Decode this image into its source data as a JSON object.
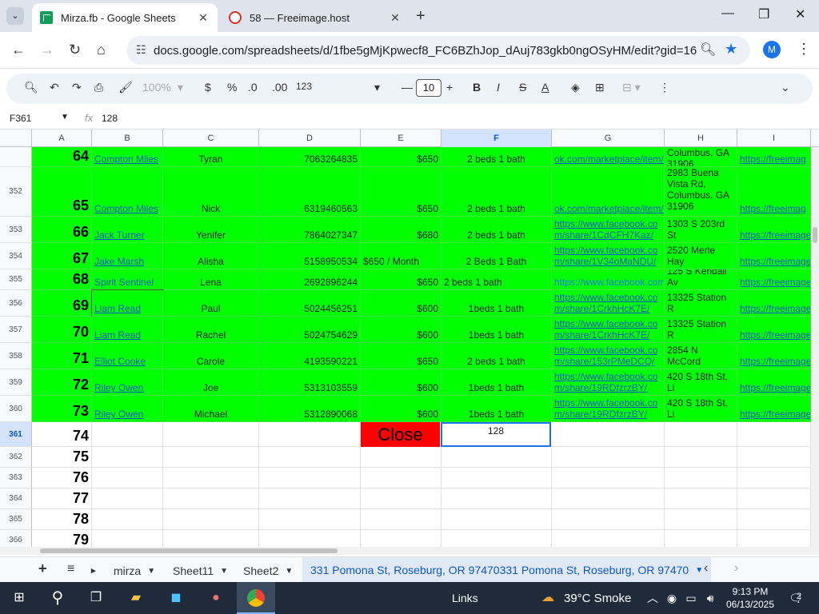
{
  "browser": {
    "tabs": [
      {
        "title": "Mirza.fb - Google Sheets",
        "active": true
      },
      {
        "title": "58 — Freeimage.host",
        "active": false
      }
    ],
    "url": "docs.google.com/spreadsheets/d/1fbe5gMjKpwecf8_FC6BZhJop_dAuj783gkb0ngOSyHM/edit?gid=166569...",
    "profile_initial": "M"
  },
  "toolbar": {
    "zoom": "100%",
    "currency": "$",
    "percent": "%",
    "dec_minus": ".0",
    "dec_plus": ".00",
    "format_123": "123",
    "font_size": "10",
    "bold": "B",
    "italic": "I",
    "strike": "S",
    "textcolor": "A"
  },
  "formula_bar": {
    "name_box": "F361",
    "fx": "fx",
    "value": "128"
  },
  "columns": [
    "A",
    "B",
    "C",
    "D",
    "E",
    "F",
    "G",
    "H",
    "I"
  ],
  "selected_column": "F",
  "rows": [
    {
      "rownum": "",
      "a": "64",
      "b": "Compton Miles",
      "c": "Tyran",
      "d": "7063264835",
      "e": "$650",
      "f": "2 beds 1 bath",
      "g": "ok.com/marketplace/item/1",
      "h": "Columbus, GA\n31906",
      "i": "https://freeimag"
    },
    {
      "rownum": "352",
      "a": "65",
      "b": "Compton Miles",
      "c": "Nick",
      "d": "6319460563",
      "e": "$650",
      "f": "2 beds 1 bath",
      "g": "ok.com/marketplace/item/1",
      "h": "2983 Buena\nVista Rd,\nColumbus, GA\n31906",
      "i": "https://freeimag"
    },
    {
      "rownum": "353",
      "a": "66",
      "b": "Jack Turner",
      "c": "Yenifer",
      "d": "7864027347",
      "e": "$680",
      "f": "2 beds 1 bath",
      "g": "https://www.facebook.co\nm/share/1CdCFH7Kaz/",
      "h": "1303 S 203rd St",
      "i": "https://freeimage"
    },
    {
      "rownum": "354",
      "a": "67",
      "b": "Jake Marsh",
      "c": "Alisha",
      "d": "5158950534",
      "e": "$650 / Month",
      "f": "2 Beds 1 Bath",
      "g": "https://www.facebook.co\nm/share/1V34oMaNDU/",
      "h": "2520 Merle Hay",
      "i": "https://freeimage"
    },
    {
      "rownum": "355",
      "a": "68",
      "b": "Spirit Sentinel",
      "c": "Lena",
      "d": "2692896244",
      "e": "$650",
      "f": "2 beds 1 bath",
      "g": "https://www.facebook.com",
      "h": "125 S Kendall Av",
      "i": "https://freeimage"
    },
    {
      "rownum": "356",
      "a": "69",
      "b": "Liam Read",
      "c": "Paul",
      "d": "5024456251",
      "e": "$600",
      "f": "1beds 1 bath",
      "g": "https://www.facebook.co\nm/share/1CrkhHcK7E/",
      "h": "13325 Station R",
      "i": "https://freeimage"
    },
    {
      "rownum": "357",
      "a": "70",
      "b": "Liam Read",
      "c": "Rachel",
      "d": "5024754629",
      "e": "$600",
      "f": "1beds 1 bath",
      "g": "https://www.facebook.co\nm/share/1CrkhHcK7E/",
      "h": "13325 Station R",
      "i": "https://freeimage"
    },
    {
      "rownum": "358",
      "a": "71",
      "b": "Elliot Cooke",
      "c": "Carole",
      "d": "4193590221",
      "e": "$650",
      "f": "2 beds 1 bath",
      "g": "https://www.facebook.co\nm/share/153rPMeDCQ/",
      "h": "2854 N McCord",
      "i": "https://freeimage"
    },
    {
      "rownum": "359",
      "a": "72",
      "b": "Riley Owen",
      "c": "Joe",
      "d": "5313103559",
      "e": "$600",
      "f": "1beds 1 bath",
      "g": "https://www.facebook.co\nm/share/19RDfzrzBY/",
      "h": "420 S 18th St, Li",
      "i": "https://freeimage"
    },
    {
      "rownum": "360",
      "a": "73",
      "b": "Riley Owen",
      "c": "Michael",
      "d": "5312890068",
      "e": "$600",
      "f": "1beds 1 bath",
      "g": "https://www.facebook.co\nm/share/19RDfzrzBY/",
      "h": "420 S 18th St, Li",
      "i": "https://freeimage"
    }
  ],
  "active_row": {
    "rownum": "361",
    "a": "74",
    "close_label": "Close",
    "f": "128"
  },
  "empty_rows": [
    {
      "rownum": "362",
      "a": "75"
    },
    {
      "rownum": "363",
      "a": "76"
    },
    {
      "rownum": "364",
      "a": "77"
    },
    {
      "rownum": "365",
      "a": "78"
    },
    {
      "rownum": "366",
      "a": "79"
    }
  ],
  "sheets": {
    "tabs": [
      "mirza",
      "Sheet11",
      "Sheet2",
      "331 Pomona St, Roseburg, OR 97470331 Pomona St, Roseburg, OR 97470"
    ],
    "active_index": 3
  },
  "taskbar": {
    "links": "Links",
    "weather": "39°C  Smoke",
    "time": "9:13 PM",
    "date": "06/13/2025",
    "notif_count": "2"
  }
}
